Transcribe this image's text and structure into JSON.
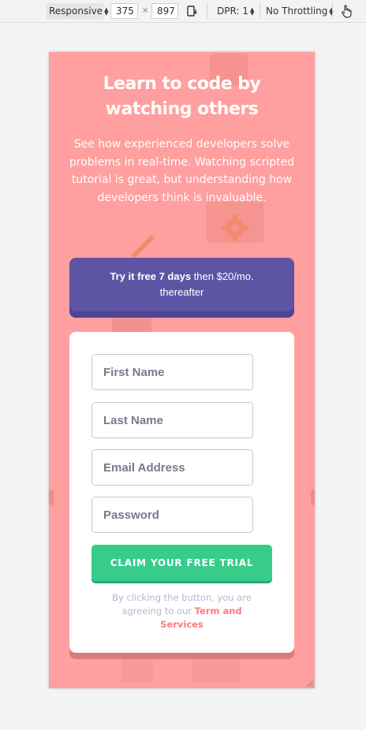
{
  "devtools": {
    "device_mode": "Responsive",
    "width": "375",
    "times": "×",
    "height": "897",
    "dpr": "DPR: 1",
    "throttling": "No Throttling",
    "rotate_icon": "rotate-icon",
    "touch_icon": "touch-hand-icon"
  },
  "hero": {
    "title": "Learn to code by watching others",
    "text": "See how experienced developers solve problems in real-time. Watching scripted tutorial is great, but understanding how developers think is invaluable."
  },
  "offer": {
    "bold_text": "Try it free 7 days",
    "rest_text": " then $20/mo. thereafter"
  },
  "form": {
    "first_name_placeholder": "First Name",
    "last_name_placeholder": "Last Name",
    "email_placeholder": "Email Address",
    "password_placeholder": "Password",
    "submit_label": "CLAIM YOUR FREE TRIAL",
    "terms_prefix": "By clicking the button, you are agreeing to our ",
    "terms_link": "Term and Services"
  },
  "colors": {
    "background": "#ff9f9f",
    "offer": "#5e54a4",
    "button": "#38cc8b",
    "link": "#ff7a7a"
  }
}
